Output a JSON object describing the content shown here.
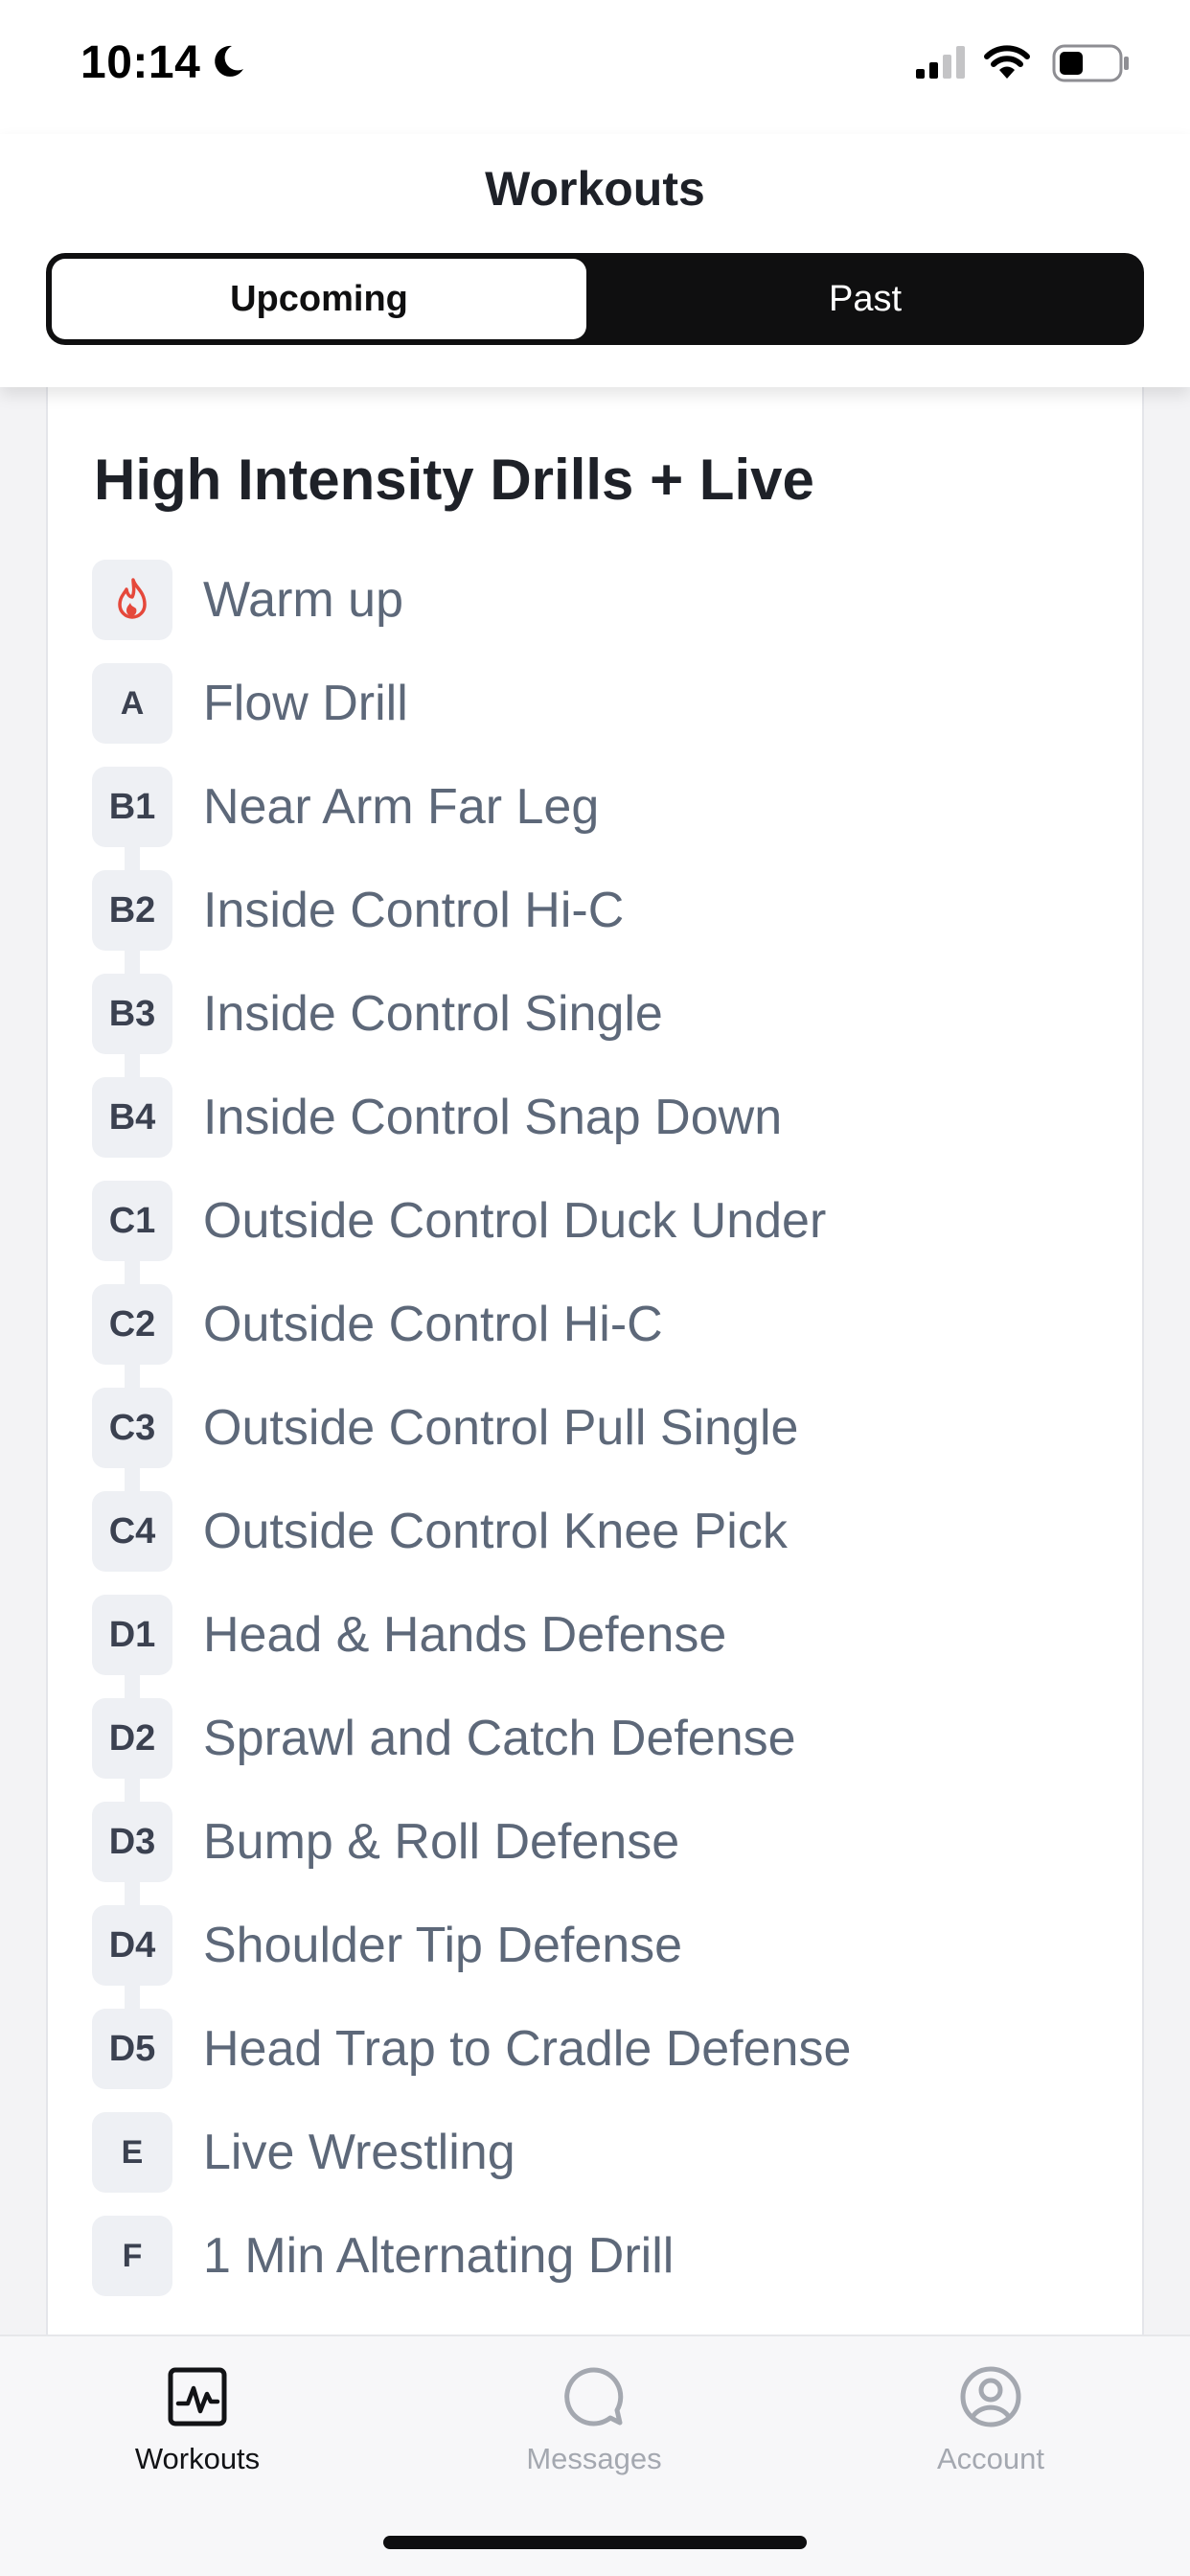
{
  "status_bar": {
    "time": "10:14"
  },
  "header": {
    "title": "Workouts",
    "tabs": [
      "Upcoming",
      "Past"
    ],
    "active_tab": "Upcoming"
  },
  "workout": {
    "title": "High Intensity Drills + Live",
    "exercises": [
      {
        "badge": "",
        "icon": "flame-icon",
        "name": "Warm up"
      },
      {
        "badge": "A",
        "name": "Flow Drill"
      },
      {
        "badge": "B1",
        "name": "Near Arm Far Leg"
      },
      {
        "badge": "B2",
        "name": "Inside Control Hi-C"
      },
      {
        "badge": "B3",
        "name": "Inside Control Single"
      },
      {
        "badge": "B4",
        "name": "Inside Control Snap Down"
      },
      {
        "badge": "C1",
        "name": "Outside Control Duck Under"
      },
      {
        "badge": "C2",
        "name": "Outside Control Hi-C"
      },
      {
        "badge": "C3",
        "name": "Outside Control Pull Single"
      },
      {
        "badge": "C4",
        "name": "Outside Control Knee Pick"
      },
      {
        "badge": "D1",
        "name": "Head & Hands Defense"
      },
      {
        "badge": "D2",
        "name": "Sprawl and Catch Defense"
      },
      {
        "badge": "D3",
        "name": "Bump & Roll Defense"
      },
      {
        "badge": "D4",
        "name": "Shoulder Tip Defense"
      },
      {
        "badge": "D5",
        "name": "Head Trap to Cradle Defense"
      },
      {
        "badge": "E",
        "name": "Live Wrestling"
      },
      {
        "badge": "F",
        "name": "1 Min Alternating Drill"
      }
    ]
  },
  "tab_bar": {
    "items": [
      {
        "label": "Workouts",
        "icon": "activity-icon",
        "active": true
      },
      {
        "label": "Messages",
        "icon": "chat-bubble-icon",
        "active": false
      },
      {
        "label": "Account",
        "icon": "user-circle-icon",
        "active": false
      }
    ]
  },
  "colors": {
    "accent_dark": "#0f0f10",
    "flame": "#e5483b",
    "exercise_text": "#5d6879",
    "badge_bg": "#eef0f4",
    "inactive_tab": "#a4a8b0"
  }
}
